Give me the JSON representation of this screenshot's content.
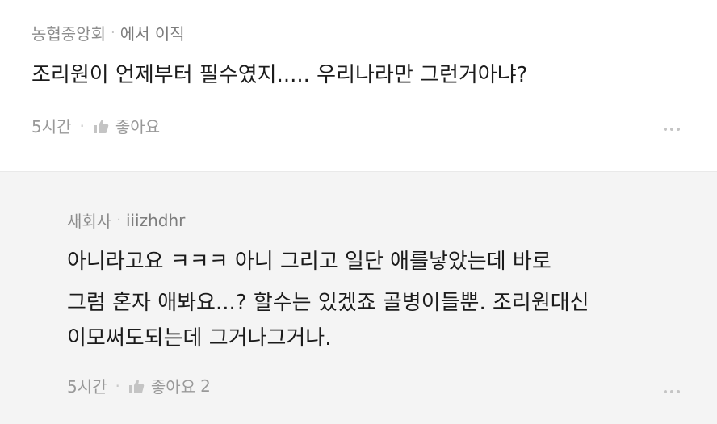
{
  "comment": {
    "author": "농협중앙회",
    "handle": "에서 이직",
    "text": "조리원이 언제부터 필수였지..... 우리나라만 그런거아냐?",
    "time": "5시간",
    "like_label": "좋아요",
    "like_count": ""
  },
  "reply": {
    "author": "새회사",
    "handle": "iiizhdhr",
    "lines": [
      "아니라고요 ㅋㅋㅋ 아니 그리고 일단 애를낳았는데 바로",
      "그럼 혼자 애봐요...? 할수는 있겠죠 골병이들뿐. 조리원대신",
      "이모써도되는데 그거나그거나."
    ],
    "time": "5시간",
    "like_label": "좋아요",
    "like_count": "2"
  },
  "separator": "·",
  "icons": {
    "like": "thumbs-up-icon",
    "more": "more-dots-icon"
  },
  "colors": {
    "reply_background": "#f4f4f4",
    "meta_text": "#8c8c8c",
    "body_text": "#1b1b1b"
  }
}
